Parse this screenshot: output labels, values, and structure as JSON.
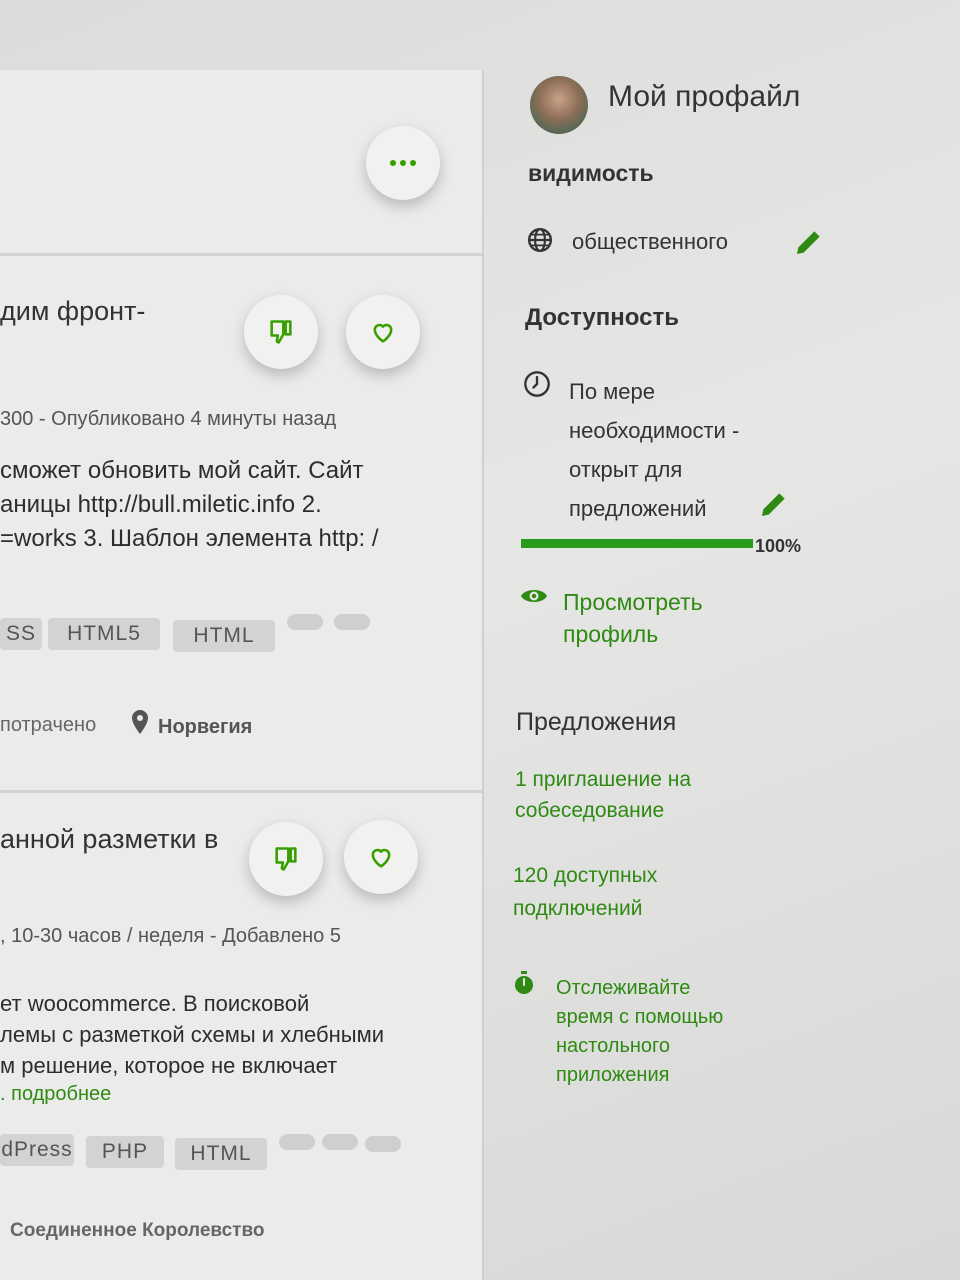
{
  "feed": {
    "job1": {
      "title": "дим фронт-",
      "meta": "300 - Опубликовано 4 минуты назад",
      "desc": [
        "сможет обновить мой сайт. Сайт",
        "аницы http://bull.miletic.info 2.",
        "=works 3. Шаблон элемента http: /"
      ],
      "tags": [
        "SS",
        "HTML5",
        "HTML"
      ],
      "spent": "потрачено",
      "location": "Норвегия"
    },
    "job2": {
      "title": "анной разметки в",
      "meta": ", 10-30 часов / неделя - Добавлено 5",
      "desc": [
        "ет woocommerce. В поисковой",
        "лемы с разметкой схемы и хлебными",
        "м решение, которое не включает"
      ],
      "more_link": ". подробнее",
      "tags": [
        "dPress",
        "PHP",
        "HTML"
      ],
      "location": "Соединенное Королевство"
    }
  },
  "sidebar": {
    "profile_title": "Мой профайл",
    "visibility_heading": "видимость",
    "visibility_value": "общественного",
    "availability_heading": "Доступность",
    "availability_lines": [
      "По мере",
      "необходимости -",
      "открыт для",
      "предложений"
    ],
    "profile_completeness": 1.0,
    "profile_completeness_label": "100%",
    "view_profile_lines": [
      "Просмотреть",
      "профиль"
    ],
    "proposals_heading": "Предложения",
    "invites_lines": [
      "1 приглашение на",
      "собеседование"
    ],
    "connects_lines": [
      "120 доступных",
      "подключений"
    ],
    "track_time_lines": [
      "Отслеживайте",
      "время с помощью",
      "настольного",
      "приложения"
    ]
  },
  "colors": {
    "accent_green": "#37a000",
    "link_green": "#2e8a12",
    "progress_green": "#2a9a1a"
  },
  "icons": {
    "more": "more-dots-icon",
    "dislike": "thumbs-down-icon",
    "like": "heart-icon",
    "location": "map-pin-icon",
    "globe": "globe-icon",
    "clock": "clock-icon",
    "edit": "pencil-icon",
    "eye": "eye-icon",
    "stopwatch": "stopwatch-icon"
  }
}
